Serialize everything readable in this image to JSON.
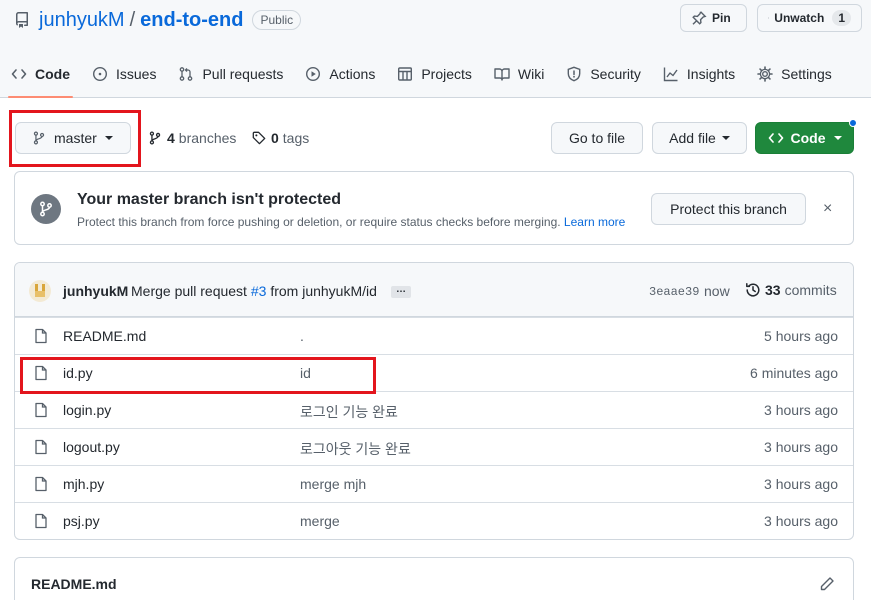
{
  "repo": {
    "owner": "junhyukM",
    "separator": "/",
    "name": "end-to-end",
    "visibility": "Public"
  },
  "header_actions": {
    "pin": "Pin",
    "unwatch": "Unwatch",
    "watch_count": "1"
  },
  "tabs": [
    {
      "label": "Code",
      "icon": "code-icon",
      "active": true
    },
    {
      "label": "Issues",
      "icon": "issue-icon"
    },
    {
      "label": "Pull requests",
      "icon": "pull-request-icon"
    },
    {
      "label": "Actions",
      "icon": "play-icon"
    },
    {
      "label": "Projects",
      "icon": "table-icon"
    },
    {
      "label": "Wiki",
      "icon": "book-icon"
    },
    {
      "label": "Security",
      "icon": "shield-icon"
    },
    {
      "label": "Insights",
      "icon": "graph-icon"
    },
    {
      "label": "Settings",
      "icon": "gear-icon"
    }
  ],
  "branch_bar": {
    "branch": "master",
    "branches_count": "4",
    "branches_label": "branches",
    "tags_count": "0",
    "tags_label": "tags",
    "go_to_file": "Go to file",
    "add_file": "Add file",
    "code": "Code"
  },
  "protect": {
    "title": "Your master branch isn't protected",
    "description": "Protect this branch from force pushing or deletion, or require status checks before merging.",
    "learn_more": "Learn more",
    "button": "Protect this branch",
    "dismiss": "×"
  },
  "latest_commit": {
    "author": "junhyukM",
    "message_prefix": "Merge pull request",
    "pr_link": "#3",
    "message_suffix": "from junhyukM/id",
    "ellipsis": "…",
    "sha": "3eaae39",
    "time": "now",
    "commits_count": "33",
    "commits_label": "commits"
  },
  "files": [
    {
      "name": "README.md",
      "message": ".",
      "time": "5 hours ago"
    },
    {
      "name": "id.py",
      "message": "id",
      "time": "6 minutes ago"
    },
    {
      "name": "login.py",
      "message": "로그인 기능 완료",
      "time": "3 hours ago"
    },
    {
      "name": "logout.py",
      "message": "로그아웃 기능 완료",
      "time": "3 hours ago"
    },
    {
      "name": "mjh.py",
      "message": "merge mjh",
      "time": "3 hours ago"
    },
    {
      "name": "psj.py",
      "message": "merge",
      "time": "3 hours ago"
    }
  ],
  "readme": {
    "title": "README.md"
  },
  "colors": {
    "highlight": "#e3151d",
    "primary_button": "#1f883d",
    "link": "#0969da",
    "active_tab_underline": "#fd8c73"
  }
}
